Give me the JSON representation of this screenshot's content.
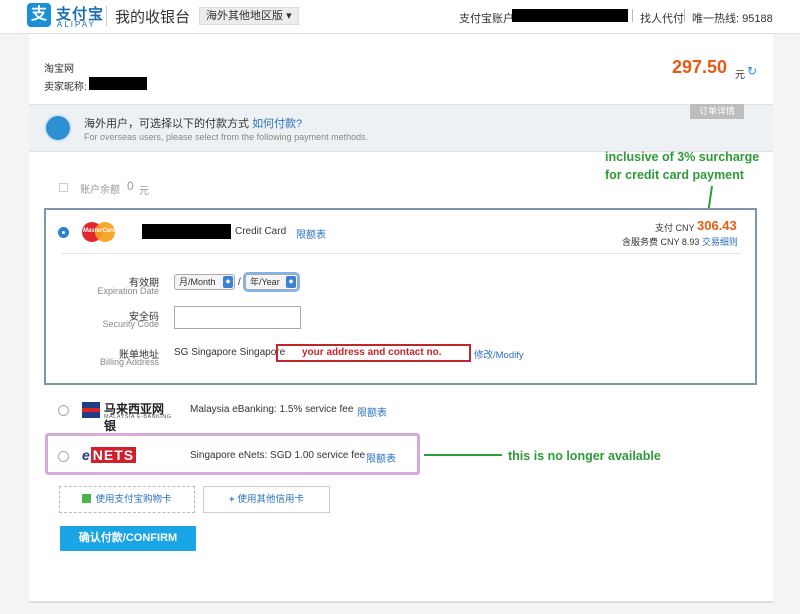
{
  "header": {
    "logo_glyph": "支",
    "logo_cn": "支付宝",
    "logo_en": "ALIPAY",
    "page_title": "我的收银台",
    "region_button": "海外其他地区版",
    "account_label": "支付宝账户:",
    "find_proxy": "找人代付",
    "hotline": "唯一热线: 95188"
  },
  "order": {
    "merchant": "淘宝网",
    "seller_label": "卖家昵称:",
    "amount": "297.50",
    "amount_unit": "元",
    "detail_tab": "订单详情"
  },
  "intro": {
    "cn_text": "海外用户，可选择以下的付款方式",
    "cn_link": "如何付款?",
    "en_text": "For overseas users, please select from the following payment methods."
  },
  "balance": {
    "label": "账户余额",
    "value": "0",
    "unit": "元"
  },
  "annotations": {
    "surcharge_line1": "inclusive of 3% surcharge",
    "surcharge_line2": "for credit card payment",
    "address_note": "your address and contact no.",
    "enets_note": "this is no longer available"
  },
  "credit_card": {
    "logo_text": "MasterCard",
    "label": "Credit Card",
    "limit_link": "限额表",
    "pay_label": "支付 CNY",
    "pay_amount": "306.43",
    "fee_text": "含服务费 CNY 8.93",
    "fee_link": "交易细则",
    "expiry_cn": "有效期",
    "expiry_en": "Expiration Date",
    "month_select": "月/Month",
    "year_select": "年/Year",
    "security_cn": "安全码",
    "security_en": "Security Code",
    "billing_cn": "账单地址",
    "billing_en": "Billing Address",
    "address_value": "SG Singapore Singapore",
    "modify_link": "修改/Modify"
  },
  "banks": {
    "malaysia_logo_cn": "马来西亚网银",
    "malaysia_logo_en": "MALAYSIA E-BANKING",
    "malaysia_desc": "Malaysia eBanking: 1.5% service fee",
    "malaysia_limit": "限额表",
    "enets_logo_e": "e",
    "enets_logo_rest": "NETS",
    "enets_desc": "Singapore eNets: SGD 1.00 service fee",
    "enets_limit": "限额表"
  },
  "actions": {
    "gift_card": "使用支付宝购物卡",
    "other_card": "使用其他信用卡",
    "confirm": "确认付款/CONFIRM"
  },
  "colors": {
    "accent_blue": "#1aa5e6",
    "amount_orange": "#e55b13",
    "annotation_green": "#2e9a3a",
    "annotation_red": "#c0272d",
    "enets_highlight": "#d7a9dc"
  }
}
